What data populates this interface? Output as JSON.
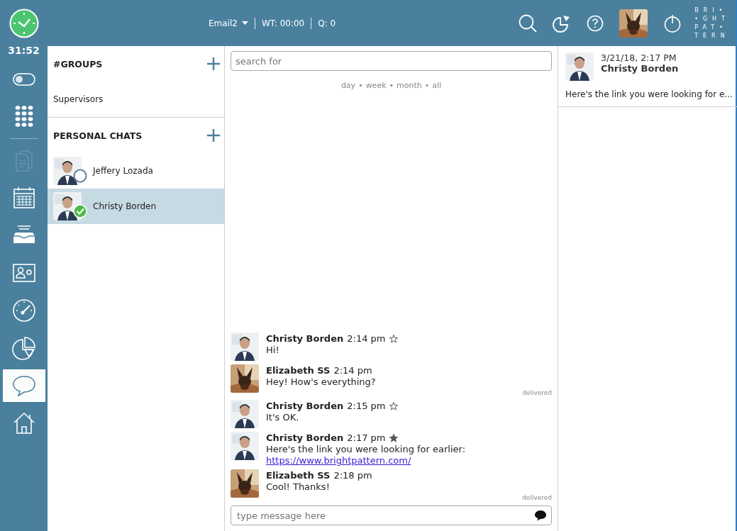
{
  "header": {
    "timer": "31:52",
    "queue": "Email2",
    "wait_time": "WT: 00:00",
    "queue_count": "Q: 0",
    "logo": [
      "BRI•",
      "•GHT",
      "PAT•",
      "TERN"
    ]
  },
  "nav": [
    {
      "kind": "toggle",
      "selected": false,
      "disabled": false
    },
    {
      "kind": "dialpad",
      "selected": false,
      "disabled": false
    },
    {
      "kind": "documents",
      "selected": false,
      "disabled": true
    },
    {
      "kind": "calendar",
      "selected": false,
      "disabled": false
    },
    {
      "kind": "inbox",
      "selected": false,
      "disabled": false
    },
    {
      "kind": "contact",
      "selected": false,
      "disabled": false
    },
    {
      "kind": "gauge",
      "selected": false,
      "disabled": false
    },
    {
      "kind": "pie",
      "selected": false,
      "disabled": false
    },
    {
      "kind": "chat",
      "selected": true,
      "disabled": false
    },
    {
      "kind": "home",
      "selected": false,
      "disabled": false
    }
  ],
  "groups": {
    "title": "#GROUPS",
    "items": [
      {
        "name": "Supervisors"
      }
    ]
  },
  "personal_chats": {
    "title": "PERSONAL CHATS",
    "items": [
      {
        "name": "Jeffery Lozada",
        "available": false,
        "selected": false
      },
      {
        "name": "Christy Borden",
        "available": true,
        "selected": true
      }
    ]
  },
  "search": {
    "placeholder": "search for"
  },
  "filters": {
    "separator": "•",
    "items": [
      "day",
      "week",
      "month",
      "all"
    ]
  },
  "messages": [
    {
      "author": "Christy Borden",
      "time": "2:14 pm",
      "starred": false,
      "text": "Hi!"
    },
    {
      "author": "Elizabeth SS",
      "time": "2:14 pm",
      "text": "Hey! How's everything?",
      "status": "delivered"
    },
    {
      "author": "Christy Borden",
      "time": "2:15 pm",
      "starred": false,
      "text": "It's OK."
    },
    {
      "author": "Christy Borden",
      "time": "2:17 pm",
      "starred": true,
      "text": "Here's the link you were looking for earlier:",
      "link": "https://www.brightpattern.com/"
    },
    {
      "author": "Elizabeth SS",
      "time": "2:18 pm",
      "text": "Cool! Thanks!",
      "status": "delivered"
    }
  ],
  "composer": {
    "placeholder": "type message here"
  },
  "recent": [
    {
      "date": "3/21/18, 2:17 PM",
      "name": "Christy Borden",
      "preview": "Here's the link you were looking for e..."
    }
  ]
}
